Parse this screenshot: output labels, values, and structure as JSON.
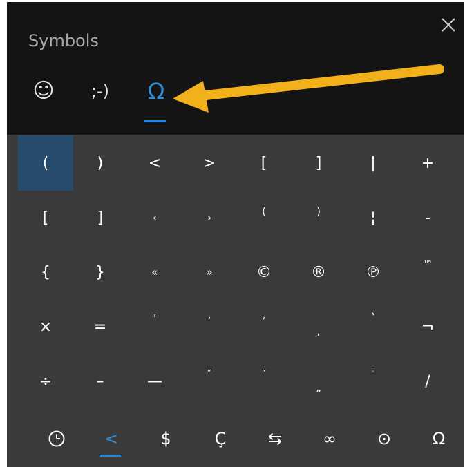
{
  "window": {
    "title": "Symbols"
  },
  "tabs": [
    {
      "id": "emoji",
      "label": "☺",
      "icon": "smiley-icon"
    },
    {
      "id": "kaomoji",
      "label": ";-)",
      "icon": "kaomoji-icon"
    },
    {
      "id": "symbols",
      "label": "Ω",
      "icon": "omega-icon",
      "active": true
    }
  ],
  "grid": {
    "rows": [
      [
        "(",
        ")",
        "<",
        ">",
        "[",
        "]",
        "|",
        "+"
      ],
      [
        "[",
        "]",
        "‹",
        "›",
        "(",
        ")",
        "¦",
        "-"
      ],
      [
        "{",
        "}",
        "«",
        "»",
        "©",
        "®",
        "℗",
        "™"
      ],
      [
        "×",
        "=",
        "'",
        "ʼ",
        "ʼ",
        ",",
        "ʽ",
        "¬"
      ],
      [
        "÷",
        "–",
        "—",
        "″",
        "″",
        "„",
        "\"",
        "/"
      ]
    ],
    "selected": [
      0,
      0
    ]
  },
  "categories": [
    {
      "label": "🕒",
      "icon": "clock-icon"
    },
    {
      "label": "<",
      "icon": "punctuation-icon",
      "active": true
    },
    {
      "label": "$",
      "icon": "currency-icon"
    },
    {
      "label": "Ç",
      "icon": "latin-icon"
    },
    {
      "label": "⇆",
      "icon": "arrows-icon"
    },
    {
      "label": "∞",
      "icon": "math-icon"
    },
    {
      "label": "⊙",
      "icon": "geometric-icon"
    },
    {
      "label": "Ω",
      "icon": "language-icon"
    }
  ],
  "colors": {
    "header_bg": "#141414",
    "panel_bg": "#3a3a3a",
    "accent": "#1e88e5",
    "selected_bg": "#264b6d",
    "arrow": "#f2b11b"
  }
}
